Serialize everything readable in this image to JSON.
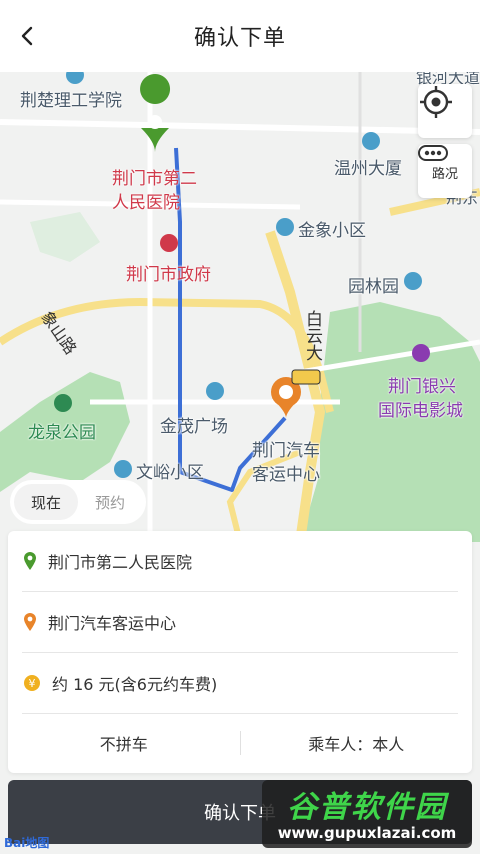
{
  "header": {
    "title": "确认下单",
    "back_icon": "chevron-left-icon"
  },
  "map": {
    "labels": {
      "jingchu": "荆楚理工学院",
      "hospital_line1": "荆门市第二",
      "hospital_line2": "人民医院",
      "gov": "荆门市政府",
      "wenzhou": "温州大厦",
      "jinxiang": "金象小区",
      "yuanlin": "园林园",
      "baiyun": "白云大",
      "xiangyilu": "象山路",
      "longquan": "龙泉公园",
      "jinmao": "金茂广场",
      "wenxiu": "文峪小区",
      "bus_line1": "荆门汽车",
      "bus_line2": "客运中心",
      "cinema_line1": "荆门银兴",
      "cinema_line2": "国际电影城",
      "top_partial": "银河大道",
      "right_partial": "荆东"
    },
    "traffic_label": "路况"
  },
  "tabs": {
    "now": "现在",
    "reserve": "预约"
  },
  "order": {
    "origin": "荆门市第二人民医院",
    "destination": "荆门汽车客运中心",
    "price": "约 16 元(含6元约车费)",
    "carpool": "不拼车",
    "passenger": "乘车人：本人"
  },
  "confirm_label": "确认下单",
  "watermark": {
    "main": "谷普软件园",
    "url": "www.gupuxlazai.com"
  },
  "baidu": "Bai地图",
  "colors": {
    "origin_pin": "#4a9a2e",
    "dest_pin": "#e8842a",
    "route": "#3d6fd6",
    "button_bg": "#3b3f46",
    "park": "#b5e0b5"
  }
}
